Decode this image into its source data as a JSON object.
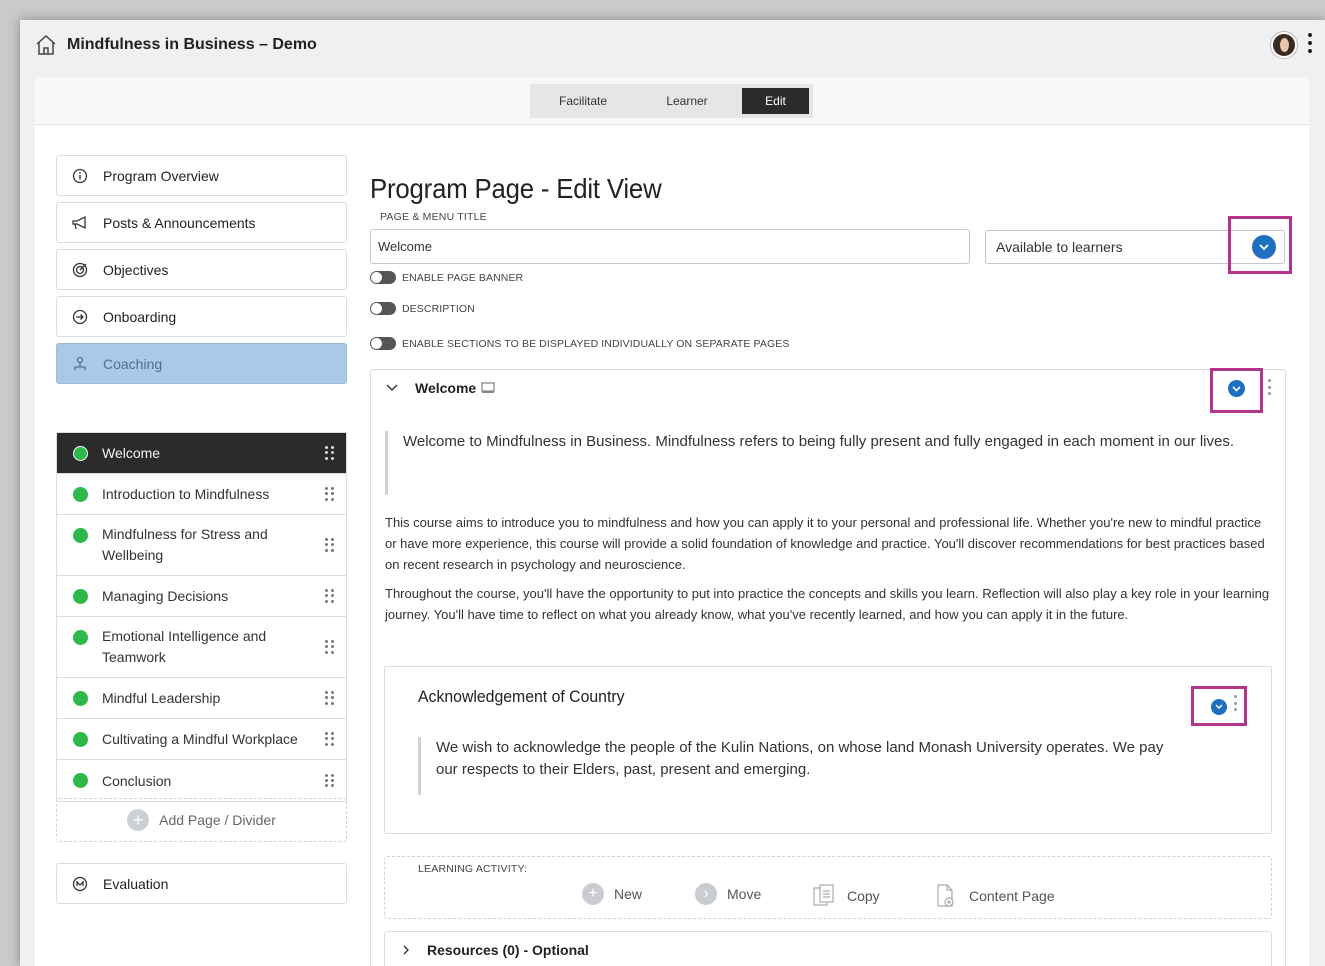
{
  "app": {
    "title": "Mindfulness in Business – Demo"
  },
  "modes": [
    "Facilitate",
    "Learner",
    "Edit"
  ],
  "sidebar": {
    "items": [
      {
        "label": "Program Overview",
        "icon": "info-icon"
      },
      {
        "label": "Posts & Announcements",
        "icon": "megaphone-icon"
      },
      {
        "label": "Objectives",
        "icon": "target-icon"
      },
      {
        "label": "Onboarding",
        "icon": "enter-icon"
      },
      {
        "label": "Coaching",
        "icon": "coaching-icon"
      }
    ],
    "pages": [
      "Welcome",
      "Introduction to Mindfulness",
      "Mindfulness for Stress and Wellbeing",
      "Managing Decisions",
      "Emotional Intelligence and Teamwork",
      "Mindful Leadership",
      "Cultivating a Mindful Workplace",
      "Conclusion"
    ],
    "add_page": "Add Page / Divider",
    "evaluation": "Evaluation"
  },
  "main": {
    "heading": "Program Page - Edit View",
    "title_label": "PAGE & MENU TITLE",
    "title_value": "Welcome",
    "availability": "Available to learners",
    "toggles": [
      "ENABLE PAGE BANNER",
      "DESCRIPTION",
      "ENABLE SECTIONS TO BE DISPLAYED INDIVIDUALLY ON SEPARATE PAGES"
    ],
    "section": {
      "title": "Welcome",
      "quote": "Welcome to Mindfulness in Business. Mindfulness refers to being fully present and fully engaged in each moment in our lives.",
      "paragraphs": [
        "This course aims to introduce you to mindfulness and how you can apply it to your personal and professional life. Whether you're new to mindful practice or have more experience, this course will provide a solid foundation of knowledge and practice. You'll discover recommendations for best practices based on recent research in psychology and neuroscience.",
        "Throughout the course, you'll have the opportunity to put into practice the concepts and skills you learn. Reflection will also play a key role in your learning journey. You'll have time to reflect on what you already know, what you've recently learned, and how you can apply it in the future."
      ],
      "ack_title": "Acknowledgement of Country",
      "ack_text": "We wish to acknowledge the people of the Kulin Nations, on whose land Monash University operates. We pay our respects to their Elders, past, present and emerging."
    },
    "learning_activity": {
      "label": "LEARNING ACTIVITY:",
      "actions": [
        "New",
        "Move",
        "Copy",
        "Content Page"
      ]
    },
    "resources": "Resources (0) - Optional"
  },
  "colors": {
    "accent": "#1f6fc1",
    "highlight": "#b5338a",
    "active_item": "#a9c9e6",
    "status_green": "#2db84b"
  }
}
